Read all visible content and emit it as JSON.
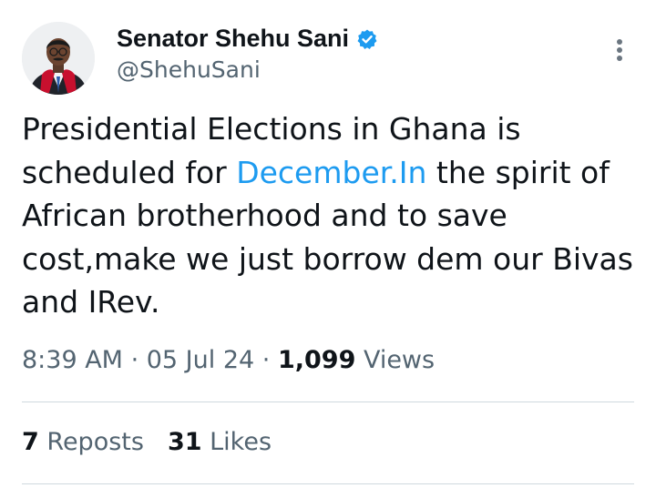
{
  "author": {
    "display_name": "Senator Shehu Sani",
    "handle": "@ShehuSani",
    "verified": true,
    "verified_icon": "verified-badge-icon",
    "accent_color": "#1d9bf0"
  },
  "tweet": {
    "text_before_link": "Presidential Elections in Ghana is scheduled for ",
    "link_text": "December.In",
    "text_after_link": " the spirit of African brotherhood and to save cost,make we just borrow dem our Bivas and IRev."
  },
  "meta": {
    "time": "8:39 AM",
    "separator": " · ",
    "date": "05 Jul 24",
    "views_count": "1,099",
    "views_label": " Views"
  },
  "stats": {
    "reposts_count": "7",
    "reposts_label": "Reposts",
    "likes_count": "31",
    "likes_label": "Likes"
  },
  "icons": {
    "more": "more-vertical-icon"
  }
}
